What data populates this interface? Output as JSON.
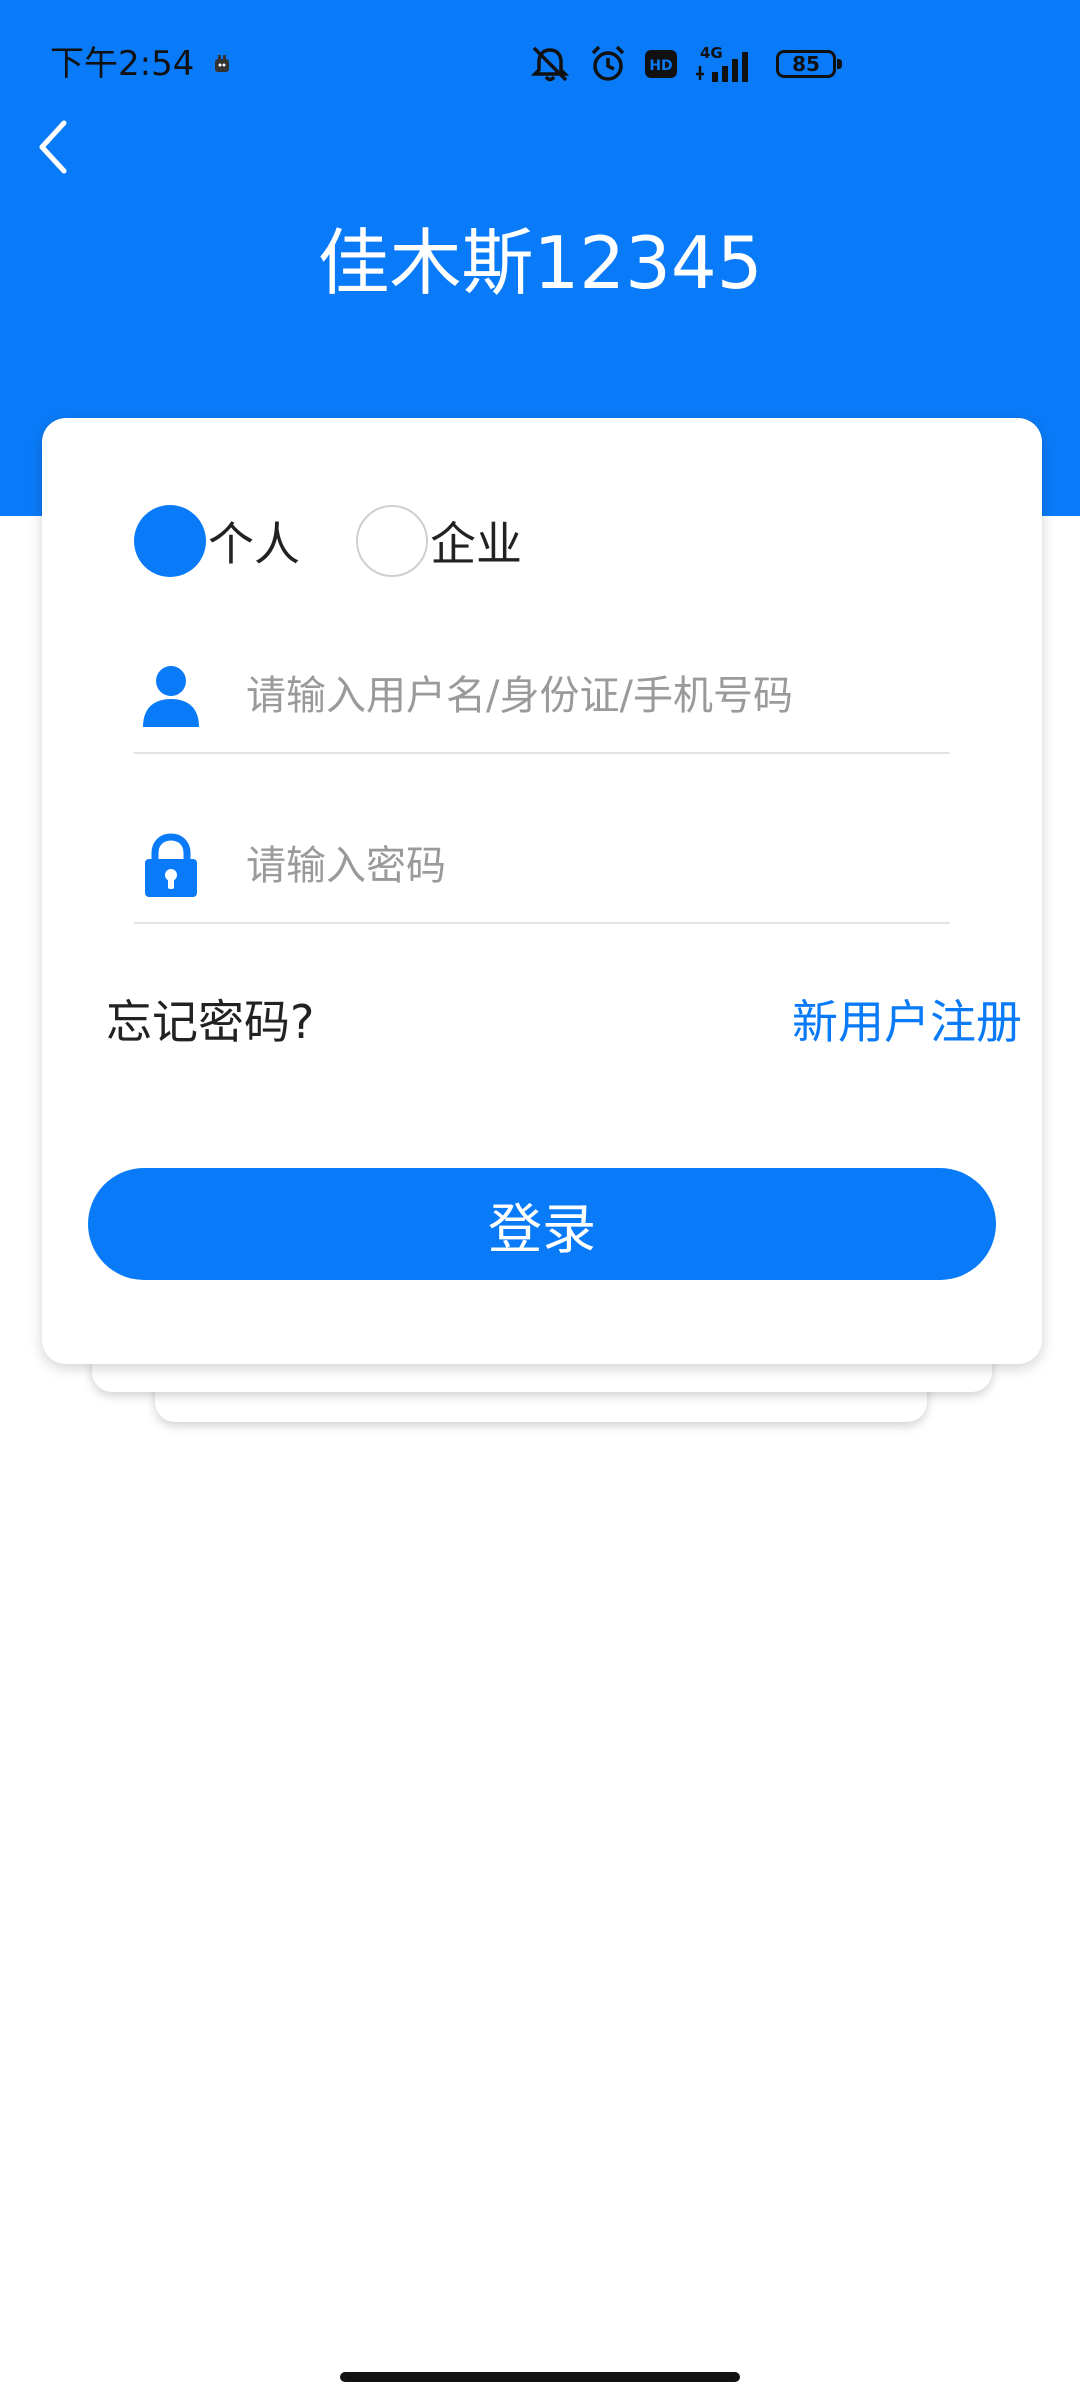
{
  "status_bar": {
    "time": "下午2:54",
    "network": "4G",
    "hd": "HD",
    "battery": "85"
  },
  "header": {
    "title": "佳木斯12345",
    "back_icon": "chevron-left-icon"
  },
  "login_type": {
    "options": [
      {
        "label": "个人",
        "checked": true
      },
      {
        "label": "企业",
        "checked": false
      }
    ]
  },
  "form": {
    "username_placeholder": "请输入用户名/身份证/手机号码",
    "username_value": "",
    "password_placeholder": "请输入密码",
    "password_value": "",
    "username_icon": "user-icon",
    "password_icon": "lock-icon"
  },
  "links": {
    "forgot": "忘记密码?",
    "register": "新用户注册"
  },
  "login_button": "登录",
  "colors": {
    "primary": "#0A7BF8",
    "text": "#222222",
    "placeholder": "#9A9A9A"
  }
}
